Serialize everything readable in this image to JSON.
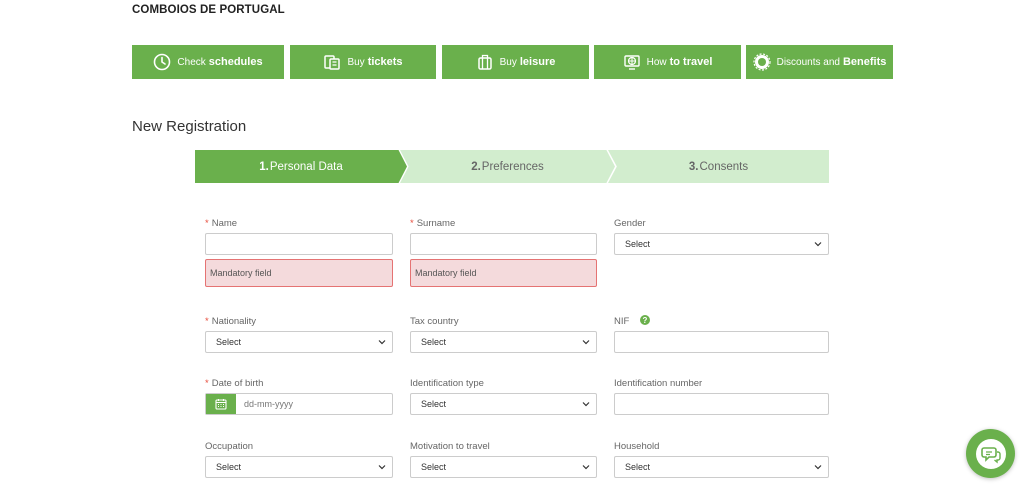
{
  "brand": {
    "name": "COMBOIOS DE PORTUGAL"
  },
  "nav": {
    "items": [
      {
        "prefix": "Check",
        "bold": "schedules",
        "icon": "clock-icon"
      },
      {
        "prefix": "Buy",
        "bold": "tickets",
        "icon": "ticket-icon"
      },
      {
        "prefix": "Buy",
        "bold": "leisure",
        "icon": "luggage-icon"
      },
      {
        "prefix": "How",
        "bold": "to travel",
        "icon": "globe-icon"
      },
      {
        "prefix": "Discounts and",
        "bold": "Benefits",
        "icon": "badge-icon"
      }
    ]
  },
  "page": {
    "title": "New Registration"
  },
  "steps": [
    {
      "num": "1.",
      "label": "Personal Data",
      "active": true
    },
    {
      "num": "2.",
      "label": "Preferences",
      "active": false
    },
    {
      "num": "3.",
      "label": "Consents",
      "active": false
    }
  ],
  "form": {
    "name": {
      "label": "Name",
      "required": "*",
      "value": "",
      "error": "Mandatory field"
    },
    "surname": {
      "label": "Surname",
      "required": "*",
      "value": "",
      "error": "Mandatory field"
    },
    "gender": {
      "label": "Gender",
      "selected": "Select"
    },
    "nationality": {
      "label": "Nationality",
      "required": "*",
      "selected": "Select"
    },
    "tax_country": {
      "label": "Tax country",
      "selected": "Select"
    },
    "nif": {
      "label": "NIF",
      "help": "?",
      "value": ""
    },
    "date_of_birth": {
      "label": "Date of birth",
      "required": "*",
      "placeholder": "dd-mm-yyyy"
    },
    "identification_type": {
      "label": "Identification type",
      "selected": "Select"
    },
    "identification_number": {
      "label": "Identification number",
      "value": ""
    },
    "occupation": {
      "label": "Occupation",
      "selected": "Select"
    },
    "motivation": {
      "label": "Motivation to travel",
      "selected": "Select"
    },
    "household": {
      "label": "Household",
      "selected": "Select"
    }
  },
  "colors": {
    "accent": "#6ab04c",
    "step_inactive": "#d2edce",
    "error_bg": "#f4dadc",
    "error_border": "#e57373",
    "required": "#e74c3c"
  }
}
